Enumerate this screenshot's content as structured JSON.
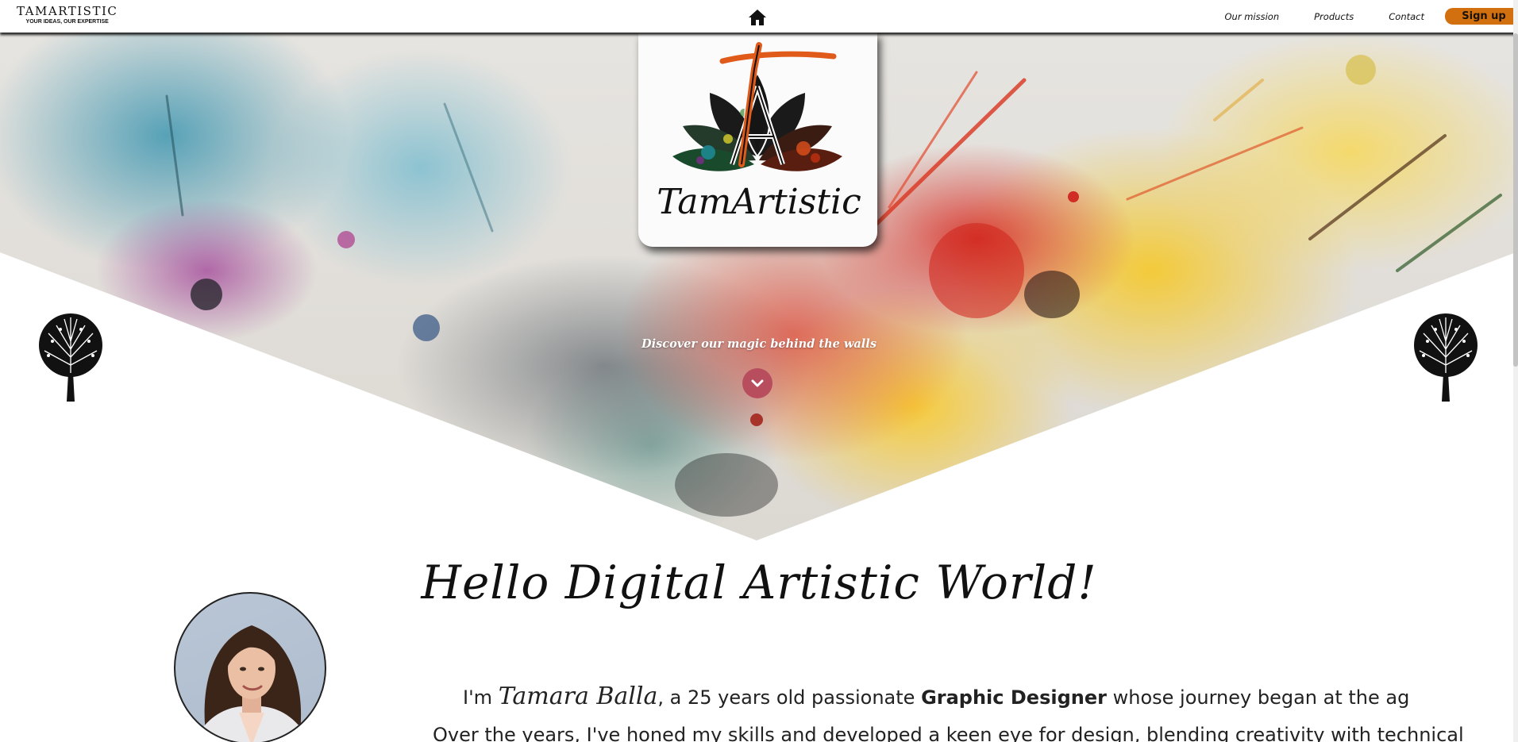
{
  "navbar": {
    "brand_name": "TAMARTISTIC",
    "brand_tagline": "YOUR IDEAS, OUR EXPERTISE",
    "home_icon": "home-icon",
    "links": [
      {
        "label": "Our mission"
      },
      {
        "label": "Products"
      },
      {
        "label": "Contact"
      }
    ],
    "signup_label": "Sign up",
    "signup_color": "#d2700f"
  },
  "hero": {
    "logo_icon": "lotus-ta-monogram-logo",
    "logo_script": "TamArtistic",
    "tagline": "Discover our magic behind the walls",
    "scroll_icon": "chevron-down-icon",
    "scroll_button_color": "#b84d5d",
    "tree_icon": "tree-icon"
  },
  "about": {
    "greeting": "Hello Digital Artistic World!",
    "intro_prefix": "I'm",
    "name": "Tamara Balla",
    "intro_middle": ", a 25 years old passionate",
    "role": "Graphic Designer",
    "intro_suffix": "whose journey began at the ag",
    "body_line": "Over the years, I've honed my skills and developed a keen eye for design, blending creativity with technical"
  }
}
